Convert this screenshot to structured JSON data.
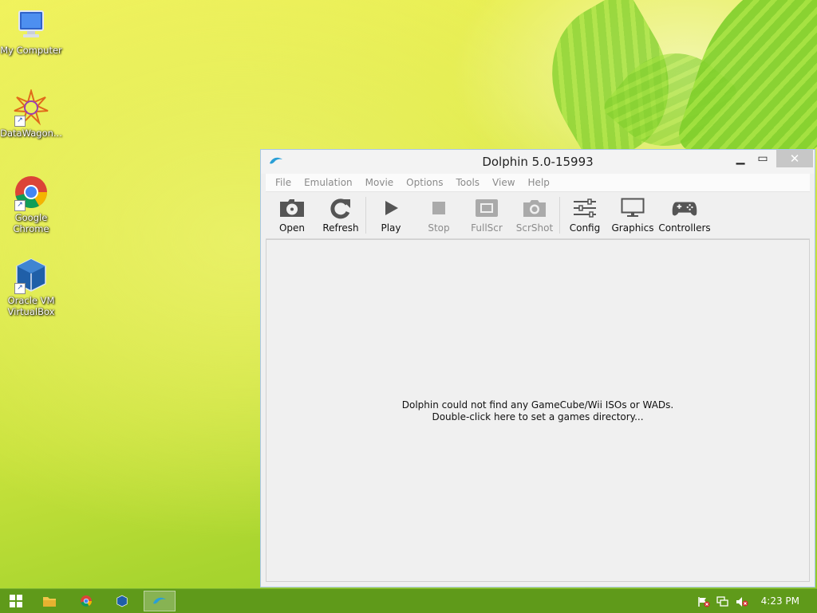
{
  "desktop": {
    "icons": [
      {
        "label": "My Computer"
      },
      {
        "label": "DataWagon..."
      },
      {
        "label_line1": "Google",
        "label_line2": "Chrome"
      },
      {
        "label_line1": "Oracle VM",
        "label_line2": "VirtualBox"
      }
    ]
  },
  "window": {
    "title": "Dolphin 5.0-15993",
    "menu": [
      "File",
      "Emulation",
      "Movie",
      "Options",
      "Tools",
      "View",
      "Help"
    ],
    "toolbar": {
      "open": "Open",
      "refresh": "Refresh",
      "play": "Play",
      "stop": "Stop",
      "fullscr": "FullScr",
      "scrshot": "ScrShot",
      "config": "Config",
      "graphics": "Graphics",
      "controllers": "Controllers"
    },
    "empty_line1": "Dolphin could not find any GameCube/Wii ISOs or WADs.",
    "empty_line2": "Double-click here to set a games directory..."
  },
  "taskbar": {
    "clock": "4:23 PM"
  },
  "colors": {
    "taskbar": "#5f9a1a",
    "window_border": "#a8c7ea",
    "disabled_text": "#8c8c8c"
  }
}
